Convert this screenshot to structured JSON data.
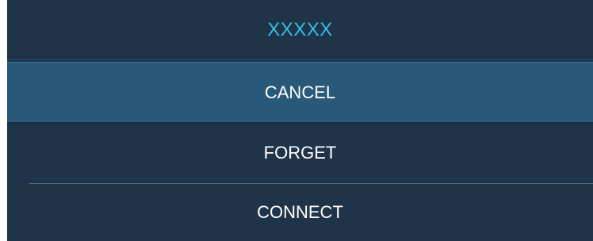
{
  "dialog": {
    "title": "XXXXX",
    "items": [
      {
        "label": "CANCEL",
        "selected": true
      },
      {
        "label": "FORGET",
        "selected": false
      },
      {
        "label": "CONNECT",
        "selected": false
      }
    ]
  },
  "colors": {
    "background": "#1f3349",
    "title_text": "#34bde6",
    "selected_row": "#29597a",
    "label_text": "#ffffff",
    "divider": "#4d6a85"
  }
}
